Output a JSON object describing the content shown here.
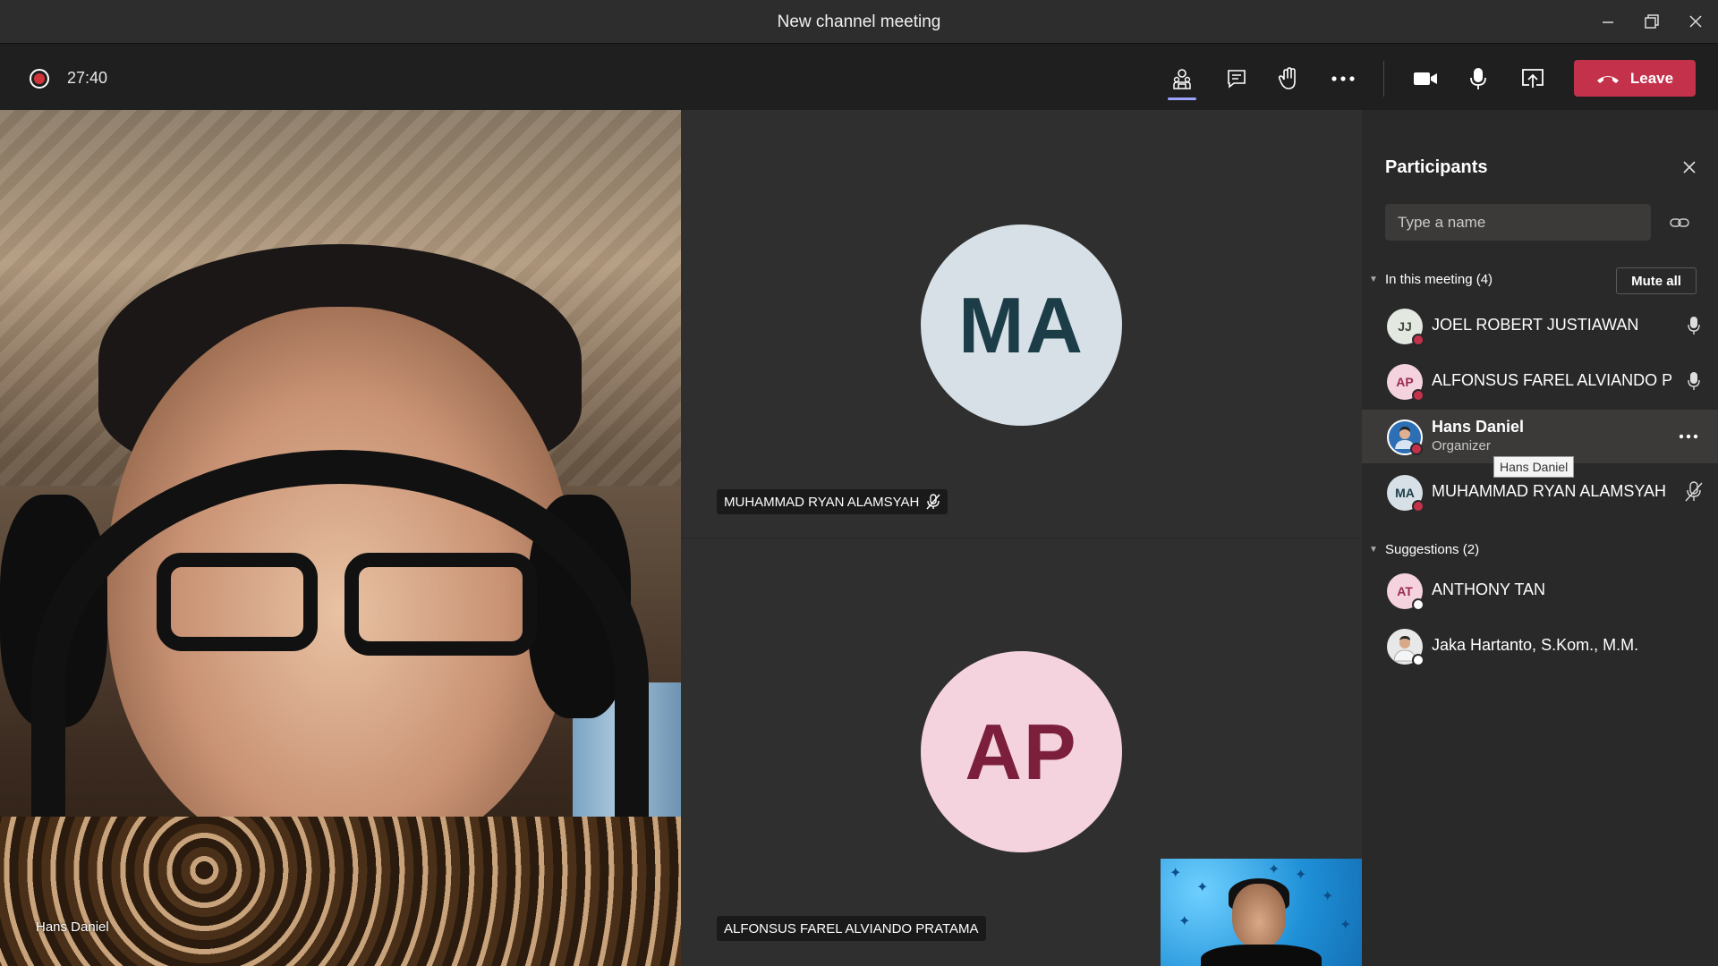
{
  "window": {
    "title": "New channel meeting"
  },
  "toolbar": {
    "timer": "27:40",
    "leave_label": "Leave"
  },
  "main_video": {
    "name": "Hans Daniel"
  },
  "tiles": [
    {
      "initials": "MA",
      "name": "MUHAMMAD RYAN ALAMSYAH",
      "muted": true
    },
    {
      "initials": "AP",
      "name": "ALFONSUS FAREL ALVIANDO PRATAMA",
      "muted": false
    }
  ],
  "participants_panel": {
    "title": "Participants",
    "search_placeholder": "Type a name",
    "in_meeting_label": "In this meeting (4)",
    "mute_all_label": "Mute all",
    "in_meeting": [
      {
        "initials": "JJ",
        "name": "JOEL ROBERT JUSTIAWAN",
        "role": "",
        "mic": "on",
        "avatar_bg": "#e3e8e1",
        "avatar_fg": "#3d4a3a"
      },
      {
        "initials": "AP",
        "name": "ALFONSUS FAREL ALVIANDO PR...",
        "role": "",
        "mic": "on",
        "avatar_bg": "#f4d3df",
        "avatar_fg": "#9b2a4f"
      },
      {
        "initials": "",
        "name": "Hans Daniel",
        "role": "Organizer",
        "mic": "more",
        "avatar_bg": "#2d6fb5",
        "avatar_fg": "#fff"
      },
      {
        "initials": "MA",
        "name": "MUHAMMAD RYAN ALAMSYAH",
        "role": "",
        "mic": "muted",
        "avatar_bg": "#d6e0e6",
        "avatar_fg": "#1c3d48"
      }
    ],
    "tooltip": "Hans Daniel",
    "suggestions_label": "Suggestions (2)",
    "suggestions": [
      {
        "initials": "AT",
        "name": "ANTHONY TAN",
        "avatar_bg": "#f4d3df",
        "avatar_fg": "#9b2a4f"
      },
      {
        "initials": "",
        "name": "Jaka Hartanto, S.Kom., M.M.",
        "avatar_bg": "#e8e8e8",
        "avatar_fg": "#333"
      }
    ]
  },
  "colors": {
    "leave_red": "#c4314b",
    "recording_red": "#d13438",
    "status_busy": "#c4314b",
    "active_underline": "#9ea2ff"
  }
}
